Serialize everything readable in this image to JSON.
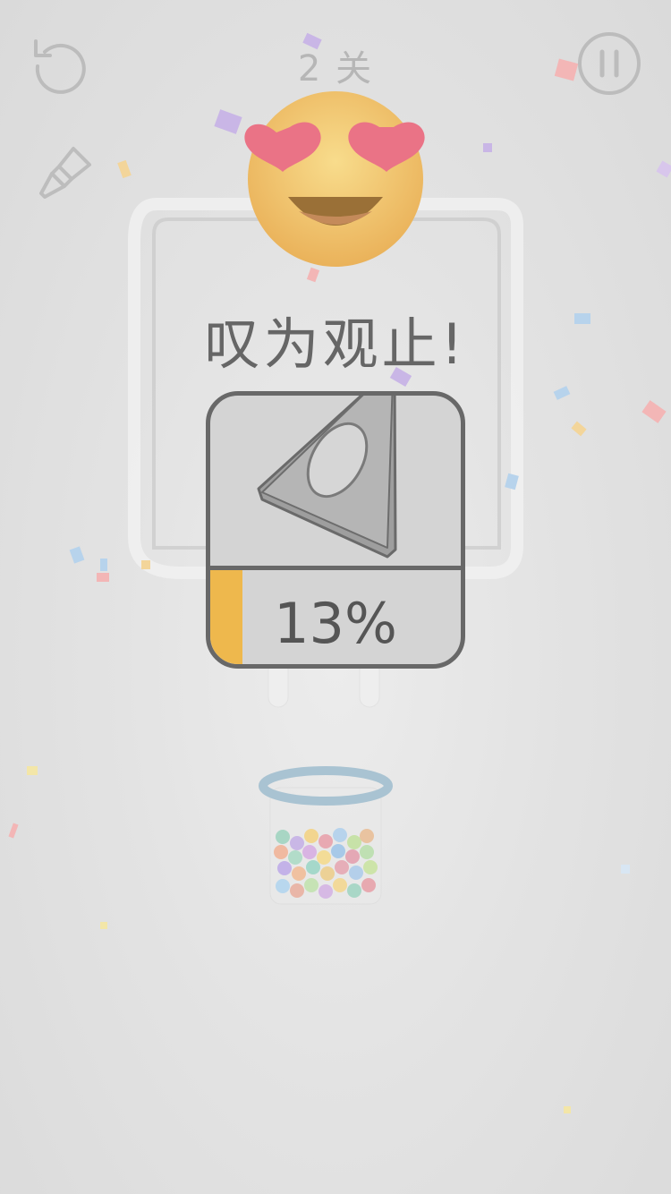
{
  "header": {
    "level_label": "2 关",
    "restart_icon": "restart-icon",
    "pause_icon": "pause-icon",
    "brush_icon": "brush-icon"
  },
  "result": {
    "emoji": "heart-eyes-emoji",
    "praise_text": "叹为观止!",
    "progress": 0.13,
    "progress_text": "13%"
  },
  "colors": {
    "progress_fill": "#eeb84d",
    "jar_rim": "#a9c3d2",
    "overlay_text": "#666666"
  }
}
